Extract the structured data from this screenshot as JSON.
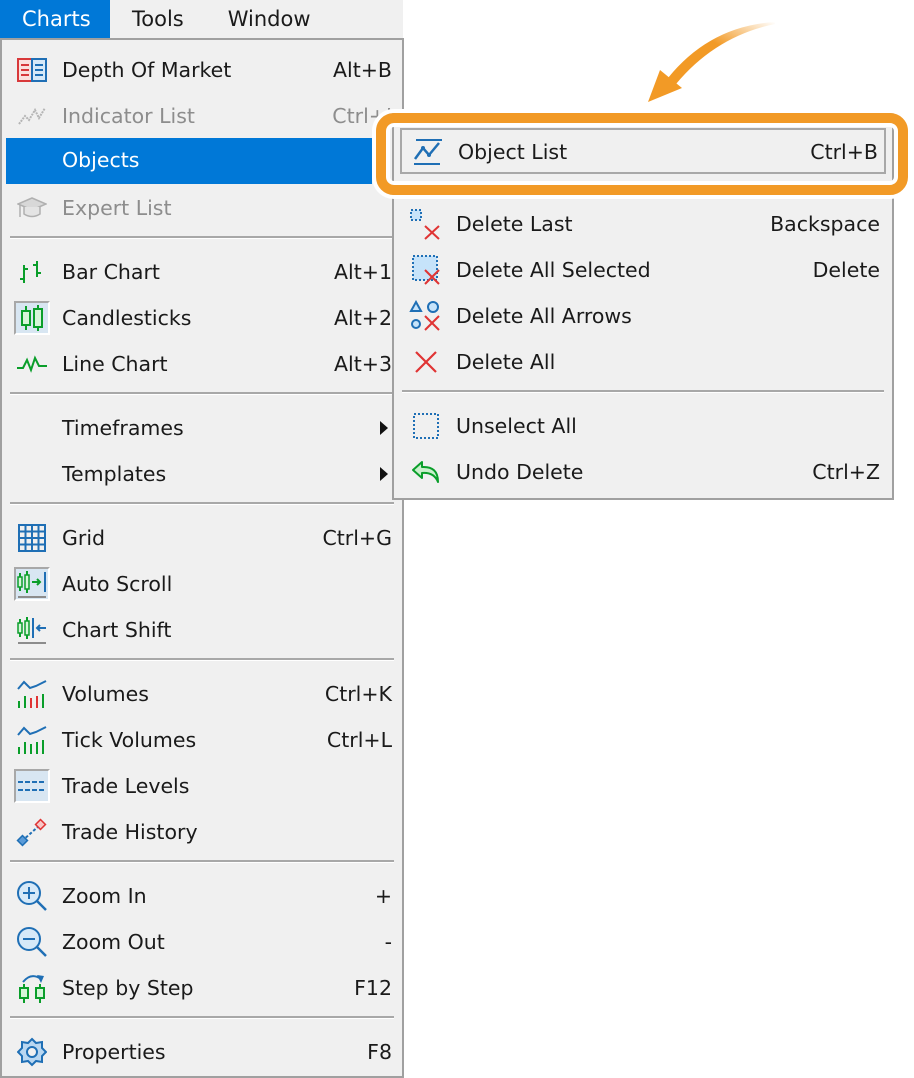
{
  "menubar": {
    "items": [
      {
        "label": "Charts",
        "active": true
      },
      {
        "label": "Tools"
      },
      {
        "label": "Window"
      }
    ]
  },
  "charts_menu": {
    "items": [
      {
        "label": "Depth Of Market",
        "shortcut": "Alt+B",
        "icon": "depth-of-market-icon"
      },
      {
        "label": "Indicator List",
        "shortcut": "Ctrl+I",
        "icon": "indicator-list-icon",
        "disabled": true
      },
      {
        "label": "Objects",
        "icon": "none",
        "highlighted": true,
        "submenu": true
      },
      {
        "label": "Expert List",
        "icon": "expert-list-icon",
        "disabled": true
      },
      {
        "label": "Bar Chart",
        "shortcut": "Alt+1",
        "icon": "bar-chart-icon"
      },
      {
        "label": "Candlesticks",
        "shortcut": "Alt+2",
        "icon": "candlesticks-icon",
        "checked": true
      },
      {
        "label": "Line Chart",
        "shortcut": "Alt+3",
        "icon": "line-chart-icon"
      },
      {
        "label": "Timeframes",
        "icon": "none",
        "submenu": true
      },
      {
        "label": "Templates",
        "icon": "none",
        "submenu": true
      },
      {
        "label": "Grid",
        "shortcut": "Ctrl+G",
        "icon": "grid-icon"
      },
      {
        "label": "Auto Scroll",
        "icon": "auto-scroll-icon",
        "checked": true
      },
      {
        "label": "Chart Shift",
        "icon": "chart-shift-icon"
      },
      {
        "label": "Volumes",
        "shortcut": "Ctrl+K",
        "icon": "volumes-icon"
      },
      {
        "label": "Tick Volumes",
        "shortcut": "Ctrl+L",
        "icon": "tick-volumes-icon"
      },
      {
        "label": "Trade Levels",
        "icon": "trade-levels-icon",
        "checked": true
      },
      {
        "label": "Trade History",
        "icon": "trade-history-icon"
      },
      {
        "label": "Zoom In",
        "shortcut": "+",
        "icon": "zoom-in-icon"
      },
      {
        "label": "Zoom Out",
        "shortcut": "-",
        "icon": "zoom-out-icon"
      },
      {
        "label": "Step by Step",
        "shortcut": "F12",
        "icon": "step-by-step-icon"
      },
      {
        "label": "Properties",
        "shortcut": "F8",
        "icon": "properties-icon"
      }
    ]
  },
  "objects_submenu": {
    "items": [
      {
        "label": "Object List",
        "shortcut": "Ctrl+B",
        "icon": "object-list-icon",
        "hovered": true
      },
      {
        "label": "Delete Last",
        "shortcut": "Backspace",
        "icon": "delete-last-icon"
      },
      {
        "label": "Delete All Selected",
        "shortcut": "Delete",
        "icon": "delete-all-selected-icon"
      },
      {
        "label": "Delete All Arrows",
        "icon": "delete-all-arrows-icon"
      },
      {
        "label": "Delete All",
        "icon": "delete-all-icon"
      },
      {
        "label": "Unselect All",
        "icon": "unselect-all-icon"
      },
      {
        "label": "Undo Delete",
        "shortcut": "Ctrl+Z",
        "icon": "undo-delete-icon"
      }
    ]
  },
  "annotation": {
    "highlight_color": "#f29a26",
    "target": "Object List"
  },
  "colors": {
    "menu_bg": "#f0f0f0",
    "highlight": "#0078d7",
    "icon_blue": "#1f6fb5",
    "icon_green": "#0a9e2a",
    "icon_red": "#e03434"
  }
}
